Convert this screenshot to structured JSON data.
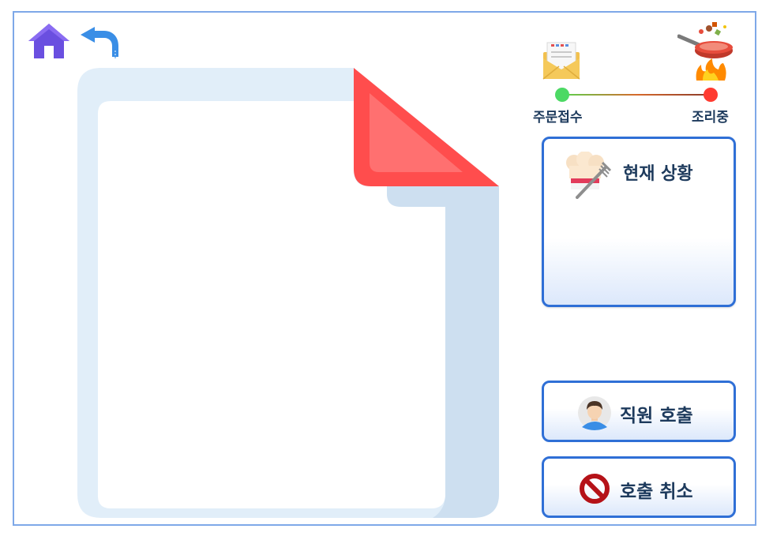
{
  "nav": {
    "home_icon": "home-icon",
    "back_icon": "back-arrow-icon"
  },
  "tracker": {
    "steps": [
      {
        "label": "주문접수",
        "icon": "envelope-icon",
        "dot_color": "#4cd964"
      },
      {
        "label": "조리중",
        "icon": "frying-pan-icon",
        "dot_color": "#ff3b30"
      }
    ]
  },
  "status_panel": {
    "title": "현재 상황",
    "icon": "chef-hat-fork-icon"
  },
  "buttons": {
    "call_staff": {
      "label": "직원 호출",
      "icon": "staff-avatar-icon"
    },
    "cancel_call": {
      "label": "호출 취소",
      "icon": "prohibited-icon"
    }
  },
  "colors": {
    "border_accent": "#2f6fd6",
    "frame_border": "#7ea8e8",
    "doc_fold": "#ff4d4d",
    "text_dark": "#1d3a5c"
  }
}
